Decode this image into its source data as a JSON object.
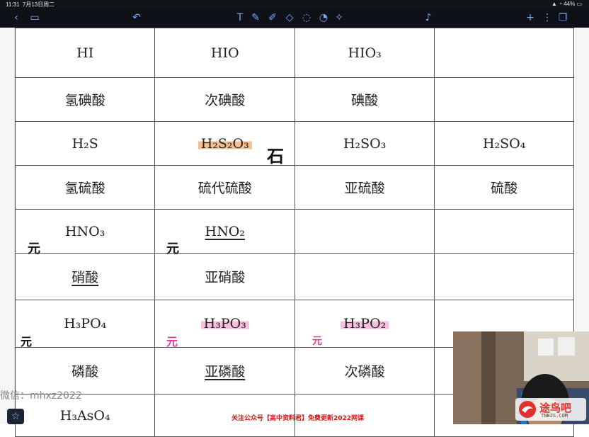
{
  "status_bar": {
    "time": "11:31",
    "date": "7月13日周二",
    "battery": "44%"
  },
  "toolbar": {
    "icons": [
      "back-chevron-icon",
      "tabs-icon",
      "undo-icon",
      "text-tool-icon",
      "pen-icon",
      "highlighter-icon",
      "eraser-icon",
      "lasso-icon",
      "shape-icon",
      "laser-icon",
      "mic-icon",
      "add-icon",
      "more-icon",
      "pages-icon"
    ]
  },
  "table": {
    "rows": [
      [
        "HI",
        "HIO",
        "HIO₃",
        ""
      ],
      [
        "氢碘酸",
        "次碘酸",
        "碘酸",
        ""
      ],
      [
        "H₂S",
        "H₂S₂O₃",
        "H₂SO₃",
        "H₂SO₄"
      ],
      [
        "氢硫酸",
        "硫代硫酸",
        "亚硫酸",
        "硫酸"
      ],
      [
        "HNO₃",
        "HNO₂",
        "",
        ""
      ],
      [
        "硝酸",
        "亚硝酸",
        "",
        ""
      ],
      [
        "H₃PO₄",
        "H₃PO₃",
        "H₃PO₂",
        ""
      ],
      [
        "磷酸",
        "亚磷酸",
        "次磷酸",
        ""
      ],
      [
        "H₃AsO₄",
        "",
        "",
        ""
      ]
    ]
  },
  "annotations": {
    "ink_mark": "元",
    "ink_mark_2": "石"
  },
  "watermark": "微信：mhxz2022",
  "banner": "关注公众号【高中资料君】免费更新2022网课",
  "logo": {
    "name": "途鸟吧",
    "url": "TNBZS.COM"
  },
  "colors": {
    "toolbar_bg": "#0e1117",
    "accent": "#7aa7ff",
    "highlight_orange": "#f3aa6e",
    "highlight_pink": "#f5aad2",
    "banner_red": "#d41515"
  }
}
